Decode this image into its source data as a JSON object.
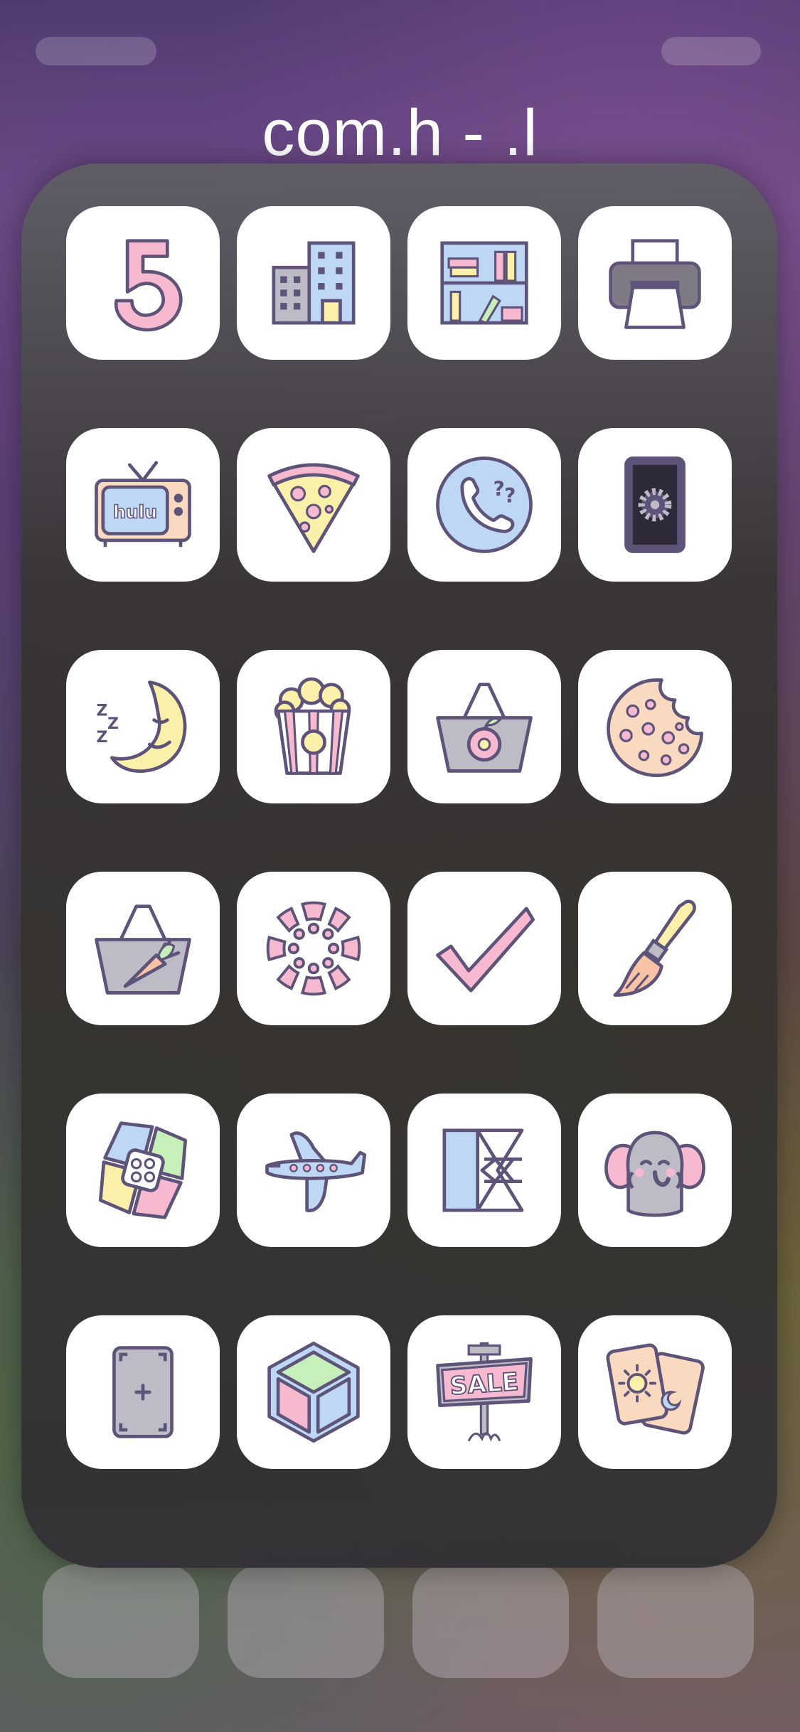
{
  "folder": {
    "title": "com.h - .l"
  },
  "apps": [
    {
      "icon": "number-five-icon"
    },
    {
      "icon": "office-building-icon"
    },
    {
      "icon": "bookshelf-icon"
    },
    {
      "icon": "printer-icon"
    },
    {
      "icon": "hulu-tv-icon",
      "label": "hulu"
    },
    {
      "icon": "pizza-slice-icon"
    },
    {
      "icon": "phone-question-icon"
    },
    {
      "icon": "smartphone-icon"
    },
    {
      "icon": "sleeping-moon-icon"
    },
    {
      "icon": "popcorn-icon"
    },
    {
      "icon": "basket-apple-icon"
    },
    {
      "icon": "cookie-icon"
    },
    {
      "icon": "basket-carrot-icon"
    },
    {
      "icon": "canvas-ring-icon"
    },
    {
      "icon": "checkmark-icon"
    },
    {
      "icon": "paintbrush-icon"
    },
    {
      "icon": "pinwheel-icon"
    },
    {
      "icon": "airplane-icon"
    },
    {
      "icon": "expressvpn-icon"
    },
    {
      "icon": "elephant-icon"
    },
    {
      "icon": "card-plus-icon"
    },
    {
      "icon": "cube-icon"
    },
    {
      "icon": "sale-sign-icon",
      "label": "SALE"
    },
    {
      "icon": "tarot-cards-icon"
    }
  ],
  "colors": {
    "outline": "#5e5379",
    "pink": "#f6b9cf",
    "yellow": "#faf0a9",
    "blue": "#bdd7f4",
    "gray": "#bdbcc6",
    "peach": "#f9d9c0",
    "green": "#c7efb9"
  }
}
